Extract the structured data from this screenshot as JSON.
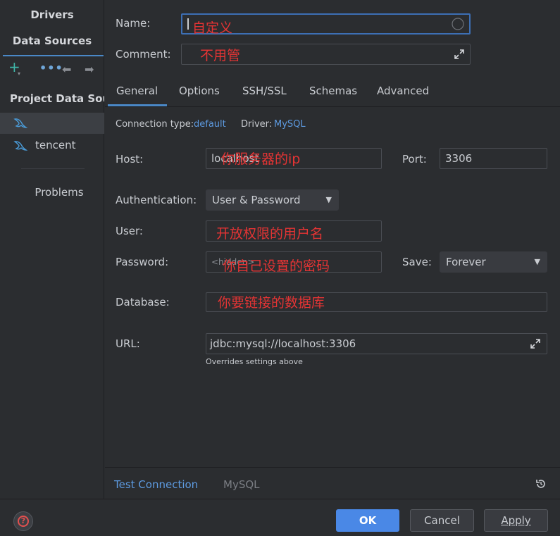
{
  "sidebar": {
    "tabs": {
      "drivers": "Drivers",
      "data_sources": "Data Sources"
    },
    "toolbar": {
      "add": "+",
      "add_caret": "▾",
      "more": "•••",
      "back": "⬅",
      "forward": "➡"
    },
    "section_title": "Project Data Sour",
    "items": [
      {
        "label": ""
      },
      {
        "label": "tencent"
      }
    ],
    "problems": "Problems"
  },
  "form": {
    "name_label": "Name:",
    "name_value": "自定义",
    "comment_label": "Comment:",
    "comment_value": "不用管",
    "tabs": [
      "General",
      "Options",
      "SSH/SSL",
      "Schemas",
      "Advanced"
    ],
    "connection_type_label": "Connection type:",
    "connection_type_value": "default",
    "driver_label": "Driver:",
    "driver_value": "MySQL",
    "host_label": "Host:",
    "host_value": "localhost",
    "host_annotation": "你服务器的ip",
    "port_label": "Port:",
    "port_value": "3306",
    "auth_label": "Authentication:",
    "auth_value": "User & Password",
    "user_label": "User:",
    "user_annotation": "开放权限的用户名",
    "password_label": "Password:",
    "password_placeholder": "<hidden>",
    "password_annotation": "你自己设置的密码",
    "save_label": "Save:",
    "save_value": "Forever",
    "database_label": "Database:",
    "database_annotation": "你要链接的数据库",
    "url_label": "URL:",
    "url_value": "jdbc:mysql://localhost:3306",
    "url_note": "Overrides settings above"
  },
  "bottom_bar": {
    "test_connection": "Test Connection",
    "driver_name": "MySQL"
  },
  "footer": {
    "help": "?",
    "ok": "OK",
    "cancel": "Cancel",
    "apply": "Apply"
  },
  "colors": {
    "accent": "#4a88c7",
    "link": "#5d9ae0",
    "annotation_red": "#e53434",
    "ok_button": "#4a88e6"
  }
}
